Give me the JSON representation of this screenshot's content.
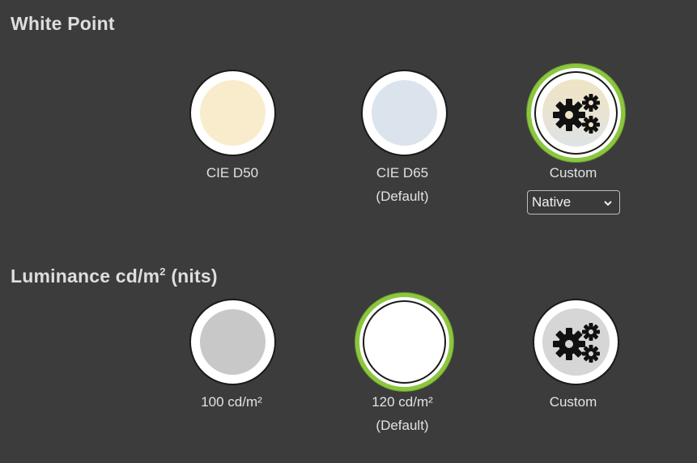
{
  "white_point": {
    "title": "White Point",
    "options": [
      {
        "label": "CIE D50",
        "sublabel": "",
        "color": "#f8eccc",
        "selected": false
      },
      {
        "label": "CIE D65",
        "sublabel": "(Default)",
        "color": "#dbe4ec",
        "selected": false
      },
      {
        "label": "Custom",
        "sublabel": "",
        "color": "#eee3c4",
        "icon": "gears-icon",
        "selected": true
      }
    ],
    "custom_select": {
      "value": "Native",
      "icon": "chevron-down-icon"
    }
  },
  "luminance": {
    "title": "Luminance cd/m",
    "title_sup": "2",
    "title_suffix": " (nits)",
    "options": [
      {
        "label": "100 cd/m²",
        "sublabel": "",
        "color": "#c8c8c8",
        "selected": false
      },
      {
        "label": "120 cd/m²",
        "sublabel": "(Default)",
        "color": "#ffffff",
        "selected": true
      },
      {
        "label": "Custom",
        "sublabel": "",
        "color": "#d6d6d6",
        "icon": "gears-icon",
        "selected": false
      }
    ]
  },
  "colors": {
    "background": "#3c3c3c",
    "selected_ring": "#8cc63f"
  }
}
